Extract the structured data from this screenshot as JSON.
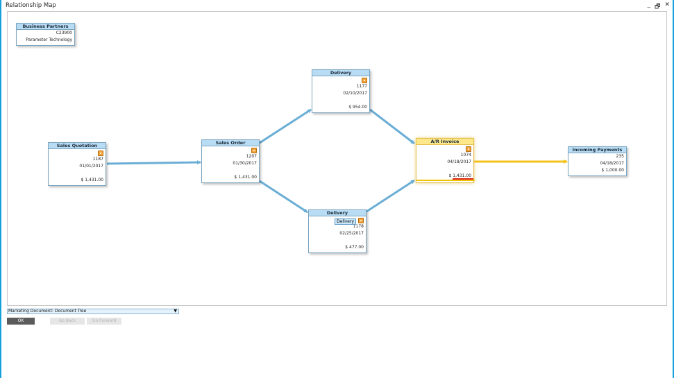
{
  "window": {
    "title": "Relationship Map",
    "controls": {
      "minimize": "_",
      "restore": "ᴴ",
      "close": "✕"
    }
  },
  "business_partner": {
    "header": "Business Partners",
    "code": "C23900",
    "name": "Parameter Technology"
  },
  "nodes": {
    "sales_quotation": {
      "header": "Sales Quotation",
      "number": "1187",
      "date": "01/01/2017",
      "amount": "$ 1,431.00"
    },
    "sales_order": {
      "header": "Sales Order",
      "number": "1207",
      "date": "01/30/2017",
      "amount": "$ 1,431.00"
    },
    "delivery_1": {
      "header": "Delivery",
      "number": "1177",
      "date": "02/10/2017",
      "amount": "$ 954.00"
    },
    "delivery_2": {
      "header": "Delivery",
      "tag": "Delivery",
      "number": "1178",
      "date": "02/25/2017",
      "amount": "$ 477.00"
    },
    "ar_invoice": {
      "header": "A/R Invoice",
      "number": "1074",
      "date": "04/18/2017",
      "amount": "$ 1,431.00"
    },
    "incoming_payments": {
      "header": "Incoming Payments",
      "number": "235",
      "date": "04/18/2017",
      "amount": "$ 1,000.00"
    }
  },
  "colors": {
    "arrow_blue": "#6aaed6",
    "arrow_yellow": "#f3c21b"
  },
  "footer": {
    "select_value": "Marketing Document: Document Tree",
    "ok_label": "OK",
    "go_back_label": "Go Back",
    "go_forward_label": "Go Forward"
  }
}
